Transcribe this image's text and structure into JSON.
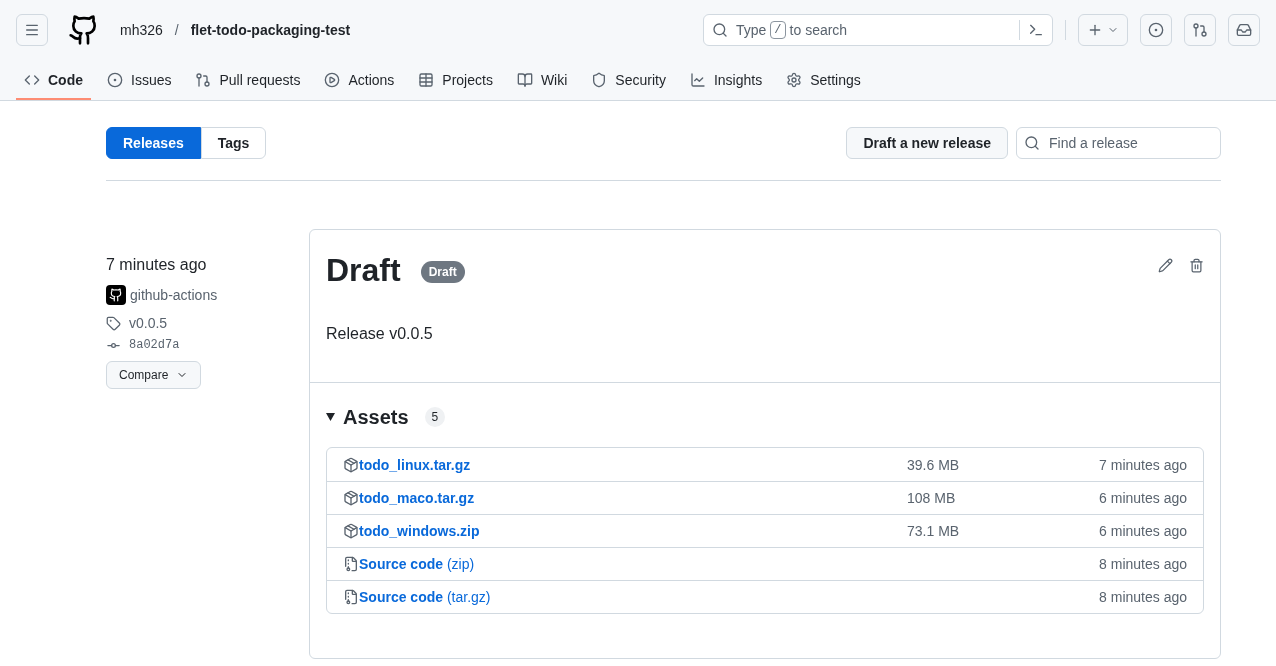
{
  "header": {
    "owner": "mh326",
    "separator": "/",
    "repo": "flet-todo-packaging-test",
    "search": {
      "before": "Type",
      "key": "/",
      "after": "to search"
    }
  },
  "nav": [
    {
      "label": "Code",
      "selected": true
    },
    {
      "label": "Issues",
      "selected": false
    },
    {
      "label": "Pull requests",
      "selected": false
    },
    {
      "label": "Actions",
      "selected": false
    },
    {
      "label": "Projects",
      "selected": false
    },
    {
      "label": "Wiki",
      "selected": false
    },
    {
      "label": "Security",
      "selected": false
    },
    {
      "label": "Insights",
      "selected": false
    },
    {
      "label": "Settings",
      "selected": false
    }
  ],
  "toggle": [
    {
      "label": "Releases",
      "selected": true
    },
    {
      "label": "Tags",
      "selected": false
    }
  ],
  "draft_button": "Draft a new release",
  "find": {
    "placeholder": "Find a release"
  },
  "release": {
    "time": "7 minutes ago",
    "author": "github-actions",
    "tag": "v0.0.5",
    "commit": "8a02d7a",
    "compare": "Compare",
    "title": "Draft",
    "badge": "Draft",
    "body": "Release v0.0.5",
    "assets_title": "Assets",
    "assets_count": "5",
    "assets": [
      {
        "kind": "package",
        "name": "todo_linux.tar.gz",
        "size": "39.6 MB",
        "time": "7 minutes ago"
      },
      {
        "kind": "package",
        "name": "todo_maco.tar.gz",
        "size": "108 MB",
        "time": "6 minutes ago"
      },
      {
        "kind": "package",
        "name": "todo_windows.zip",
        "size": "73.1 MB",
        "time": "6 minutes ago"
      },
      {
        "kind": "source",
        "name": "Source code",
        "suffix": "(zip)",
        "time": "8 minutes ago"
      },
      {
        "kind": "source",
        "name": "Source code",
        "suffix": "(tar.gz)",
        "time": "8 minutes ago"
      }
    ]
  }
}
